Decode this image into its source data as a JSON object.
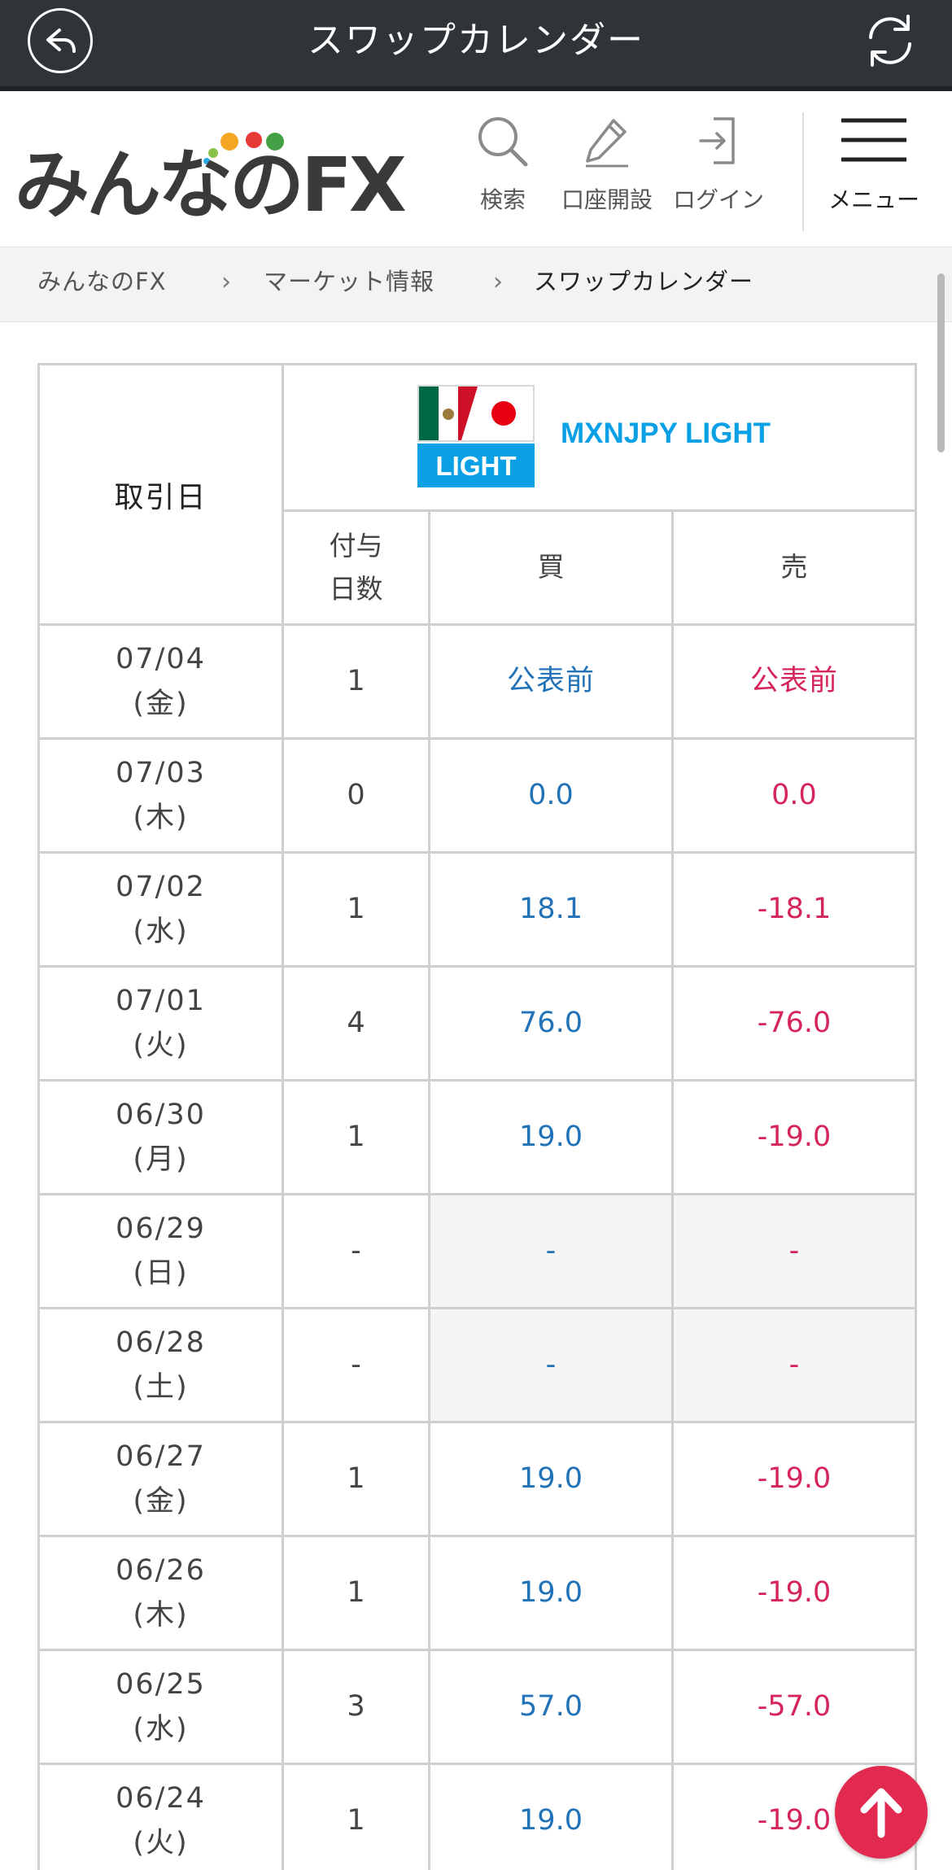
{
  "appbar": {
    "title": "スワップカレンダー",
    "back_icon": "reply-arrow-icon",
    "refresh_icon": "refresh-icon",
    "bg_color": "#2e3438"
  },
  "header": {
    "logo_text": "みんなのFX",
    "search_label": "検索",
    "account_label": "口座開設",
    "login_label": "ログイン",
    "menu_label": "メニュー"
  },
  "breadcrumb": {
    "items": [
      "みんなのFX",
      "マーケット情報",
      "スワップカレンダー"
    ],
    "separator": "›"
  },
  "table": {
    "date_header": "取引日",
    "pair_name": "MXNJPY LIGHT",
    "pair_badge": "LIGHT",
    "days_header": "付与\n日数",
    "buy_header": "買",
    "sell_header": "売",
    "colors": {
      "buy": "#2272b8",
      "sell": "#d6255a",
      "pair": "#0aa0e6"
    },
    "rows": [
      {
        "date": "07/04",
        "weekday": "(金)",
        "days": "1",
        "buy": "公表前",
        "sell": "公表前"
      },
      {
        "date": "07/03",
        "weekday": "(木)",
        "days": "0",
        "buy": "0.0",
        "sell": "0.0"
      },
      {
        "date": "07/02",
        "weekday": "(水)",
        "days": "1",
        "buy": "18.1",
        "sell": "-18.1"
      },
      {
        "date": "07/01",
        "weekday": "(火)",
        "days": "4",
        "buy": "76.0",
        "sell": "-76.0"
      },
      {
        "date": "06/30",
        "weekday": "(月)",
        "days": "1",
        "buy": "19.0",
        "sell": "-19.0"
      },
      {
        "date": "06/29",
        "weekday": "(日)",
        "days": "-",
        "buy": "-",
        "sell": "-"
      },
      {
        "date": "06/28",
        "weekday": "(土)",
        "days": "-",
        "buy": "-",
        "sell": "-"
      },
      {
        "date": "06/27",
        "weekday": "(金)",
        "days": "1",
        "buy": "19.0",
        "sell": "-19.0"
      },
      {
        "date": "06/26",
        "weekday": "(木)",
        "days": "1",
        "buy": "19.0",
        "sell": "-19.0"
      },
      {
        "date": "06/25",
        "weekday": "(水)",
        "days": "3",
        "buy": "57.0",
        "sell": "-57.0"
      },
      {
        "date": "06/24",
        "weekday": "(火)",
        "days": "1",
        "buy": "19.0",
        "sell": "-19.0"
      }
    ]
  },
  "fab": {
    "icon": "arrow-up-icon",
    "color": "#e2294f"
  }
}
